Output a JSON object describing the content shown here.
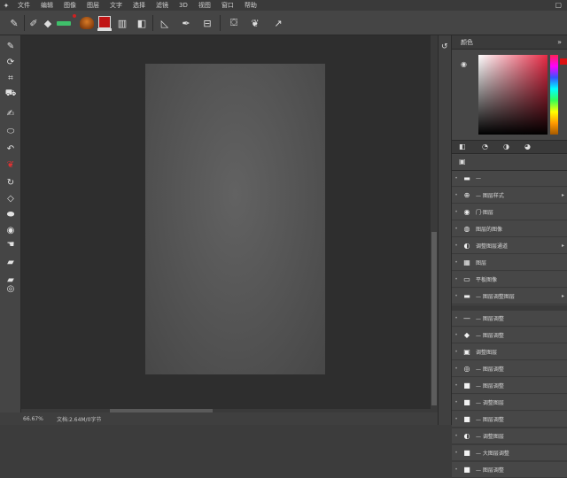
{
  "menubar": {
    "items": [
      "文件",
      "编辑",
      "图像",
      "图层",
      "文字",
      "选择",
      "滤镜",
      "3D",
      "视图",
      "窗口",
      "帮助"
    ],
    "window_control": "▢"
  },
  "options_bar": {
    "tools": [
      {
        "name": "brush-preset-icon",
        "glyph": "✎"
      },
      {
        "name": "brush-options-icon",
        "glyph": "✐"
      },
      {
        "name": "diamond-icon",
        "glyph": "◆"
      },
      {
        "name": "mode-icon",
        "glyph": "▥"
      },
      {
        "name": "flip-icon",
        "glyph": "◧"
      },
      {
        "name": "flag-icon",
        "glyph": "⚑"
      },
      {
        "name": "pen-icon",
        "glyph": "✒"
      },
      {
        "name": "angle-icon",
        "glyph": "◺"
      },
      {
        "name": "dropper-icon",
        "glyph": "⟋"
      },
      {
        "name": "transform-icon",
        "glyph": "⊟"
      },
      {
        "name": "bucket-icon",
        "glyph": "⛋"
      },
      {
        "name": "cherries-icon",
        "glyph": "❦"
      },
      {
        "name": "arrow-icon",
        "glyph": "↗"
      }
    ],
    "colors": {
      "slider": "#3fbf6a",
      "swatch": "#c01414",
      "brush": "#d87a26"
    }
  },
  "toolbar": {
    "tools": [
      {
        "name": "collapse-icon",
        "glyph": "≫"
      },
      {
        "name": "paint-icon",
        "glyph": "✎"
      },
      {
        "name": "lasso-icon",
        "glyph": "⟳"
      },
      {
        "name": "crop-icon",
        "glyph": "⌗"
      },
      {
        "name": "stamp-icon",
        "glyph": "⛟"
      },
      {
        "name": "pen-tool-icon",
        "glyph": "✍"
      },
      {
        "name": "eraser-icon",
        "glyph": "⬭"
      },
      {
        "name": "undo-icon",
        "glyph": "↶"
      },
      {
        "name": "cherry-icon",
        "glyph": "❦"
      },
      {
        "name": "rotate-icon",
        "glyph": "↻"
      },
      {
        "name": "shape-icon",
        "glyph": "◇"
      },
      {
        "name": "drop-icon",
        "glyph": "⬬"
      },
      {
        "name": "blur-icon",
        "glyph": "◉"
      },
      {
        "name": "hand-icon",
        "glyph": "☚"
      },
      {
        "name": "film-icon",
        "glyph": "▰"
      },
      {
        "name": "zoom-icon",
        "glyph": "◎"
      }
    ]
  },
  "statusbar": {
    "zoom": "66.67%",
    "doc": "文档:2.64M/0字节"
  },
  "right_panel": {
    "color_panel_title": "颜色",
    "close_glyph": "»",
    "picker_colors": {
      "hue": "#e62a45",
      "marker": "#dd1111"
    },
    "adj_icons": [
      {
        "name": "adjust-1-icon",
        "glyph": "◧"
      },
      {
        "name": "adjust-2-icon",
        "glyph": "◔"
      },
      {
        "name": "adjust-3-icon",
        "glyph": "◑"
      },
      {
        "name": "adjust-4-icon",
        "glyph": "◕"
      }
    ],
    "layers_title_glyph": "▣",
    "rows": [
      {
        "icon": "▬",
        "label": "—",
        "arrow": ""
      },
      {
        "icon": "⊕",
        "label": "— 图层样式",
        "arrow": "▸"
      },
      {
        "icon": "◉",
        "label": "门·图层",
        "arrow": ""
      },
      {
        "icon": "◍",
        "label": "图层的图像",
        "arrow": ""
      },
      {
        "icon": "◐",
        "label": "调整图层通道",
        "arrow": "▸"
      },
      {
        "icon": "▦",
        "label": "图层",
        "arrow": ""
      },
      {
        "icon": "▭",
        "label": "平板图像",
        "arrow": ""
      },
      {
        "icon": "▬",
        "label": "— 图层调整图层",
        "arrow": "▸"
      },
      {
        "icon": "—",
        "label": "— 图层调整",
        "arrow": ""
      },
      {
        "icon": "◆",
        "label": "— 图层调整",
        "arrow": ""
      },
      {
        "icon": "▣",
        "label": "调整图层",
        "arrow": ""
      },
      {
        "icon": "◎",
        "label": "— 图层调整",
        "arrow": ""
      },
      {
        "icon": "■",
        "label": "— 图层调整",
        "arrow": ""
      },
      {
        "icon": "■",
        "label": "— 调整图层",
        "arrow": ""
      },
      {
        "icon": "■",
        "label": "— 图层调整",
        "arrow": ""
      },
      {
        "icon": "◐",
        "label": "— 调整图层",
        "arrow": ""
      },
      {
        "icon": "■",
        "label": "— 大图层调整",
        "arrow": ""
      },
      {
        "icon": "■",
        "label": "— 图层调整",
        "arrow": ""
      }
    ]
  }
}
